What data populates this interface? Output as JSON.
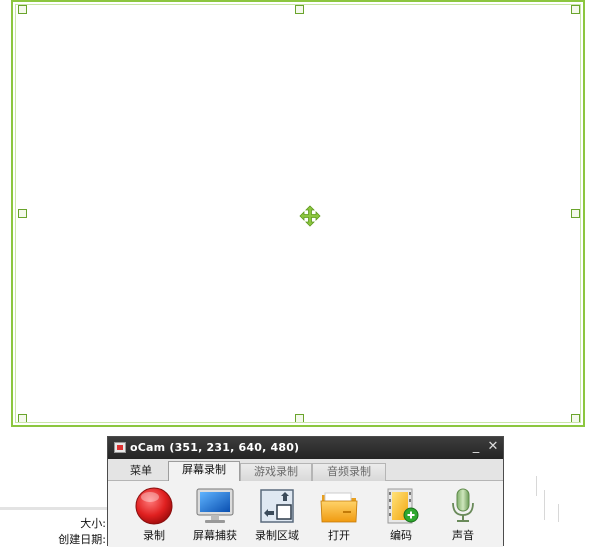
{
  "window": {
    "title": "oCam (351, 231, 640, 480)",
    "minimize_glyph": "_",
    "close_glyph": "✕"
  },
  "tabs": [
    {
      "label": "菜单",
      "state": "plain"
    },
    {
      "label": "屏幕录制",
      "state": "active"
    },
    {
      "label": "游戏录制",
      "state": "inactive"
    },
    {
      "label": "音频录制",
      "state": "inactive"
    }
  ],
  "toolbar": [
    {
      "label": "录制",
      "icon": "record-icon"
    },
    {
      "label": "屏幕捕获",
      "icon": "monitor-icon"
    },
    {
      "label": "录制区域",
      "icon": "resize-area-icon"
    },
    {
      "label": "打开",
      "icon": "folder-icon"
    },
    {
      "label": "编码",
      "icon": "film-add-icon"
    },
    {
      "label": "声音",
      "icon": "microphone-icon"
    }
  ],
  "file_info": {
    "size_label": "大小:",
    "created_label": "创建日期:"
  },
  "colors": {
    "frame_border": "#8cc63f",
    "titlebar": "#2e2e2e",
    "record_red": "#e02020"
  }
}
